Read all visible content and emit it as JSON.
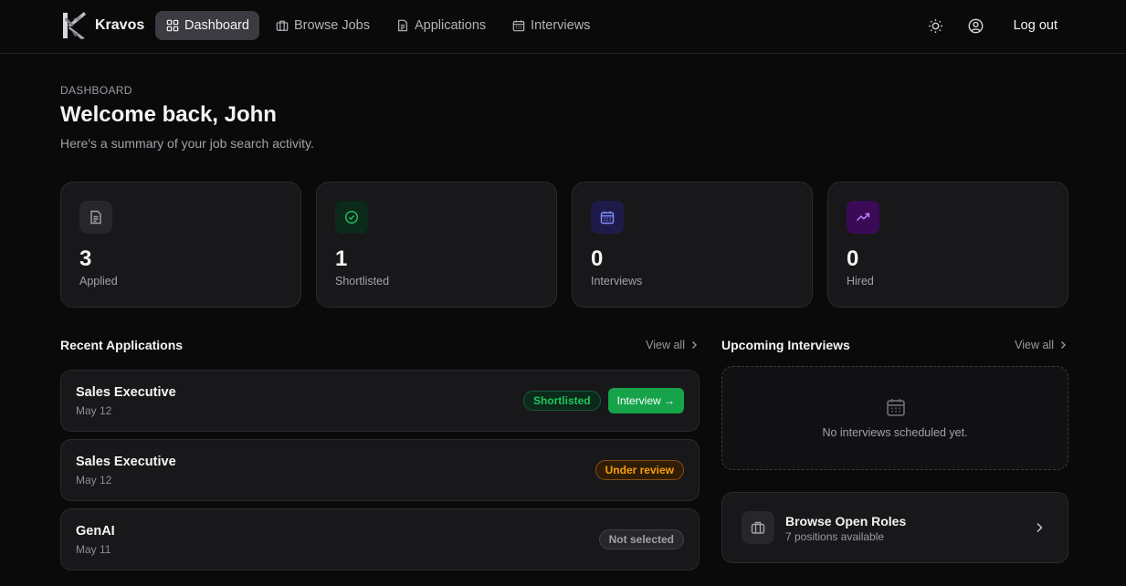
{
  "brand": {
    "name": "Kravos"
  },
  "nav": {
    "items": [
      {
        "label": "Dashboard",
        "icon": "dashboard-icon",
        "active": true
      },
      {
        "label": "Browse Jobs",
        "icon": "briefcase-icon",
        "active": false
      },
      {
        "label": "Applications",
        "icon": "file-icon",
        "active": false
      },
      {
        "label": "Interviews",
        "icon": "calendar-icon",
        "active": false
      }
    ],
    "theme_icon": "sun-icon",
    "profile_icon": "user-circle-icon",
    "logout_label": "Log out"
  },
  "header": {
    "eyebrow": "DASHBOARD",
    "title": "Welcome back, John",
    "subtitle": "Here's a summary of your job search activity."
  },
  "stats": [
    {
      "value": "3",
      "label": "Applied",
      "icon": "file-icon",
      "color": "#a1a1aa",
      "bg": "#27272a"
    },
    {
      "value": "1",
      "label": "Shortlisted",
      "icon": "check-circle-icon",
      "color": "#22c55e",
      "bg": "#0b2a19"
    },
    {
      "value": "0",
      "label": "Interviews",
      "icon": "calendar-icon",
      "color": "#818cf8",
      "bg": "#1e1b4b"
    },
    {
      "value": "0",
      "label": "Hired",
      "icon": "trending-up-icon",
      "color": "#c084fc",
      "bg": "#3b0a57"
    }
  ],
  "recent_applications": {
    "title": "Recent Applications",
    "view_all": "View all",
    "items": [
      {
        "title": "Sales Executive",
        "date": "May 12",
        "status": "Shortlisted",
        "status_kind": "shortlisted",
        "action": "Interview →"
      },
      {
        "title": "Sales Executive",
        "date": "May 12",
        "status": "Under review",
        "status_kind": "review"
      },
      {
        "title": "GenAI",
        "date": "May 11",
        "status": "Not selected",
        "status_kind": "rejected"
      }
    ]
  },
  "upcoming_interviews": {
    "title": "Upcoming Interviews",
    "view_all": "View all",
    "empty_text": "No interviews scheduled yet."
  },
  "browse_roles": {
    "title": "Browse Open Roles",
    "subtitle": "7 positions available"
  }
}
